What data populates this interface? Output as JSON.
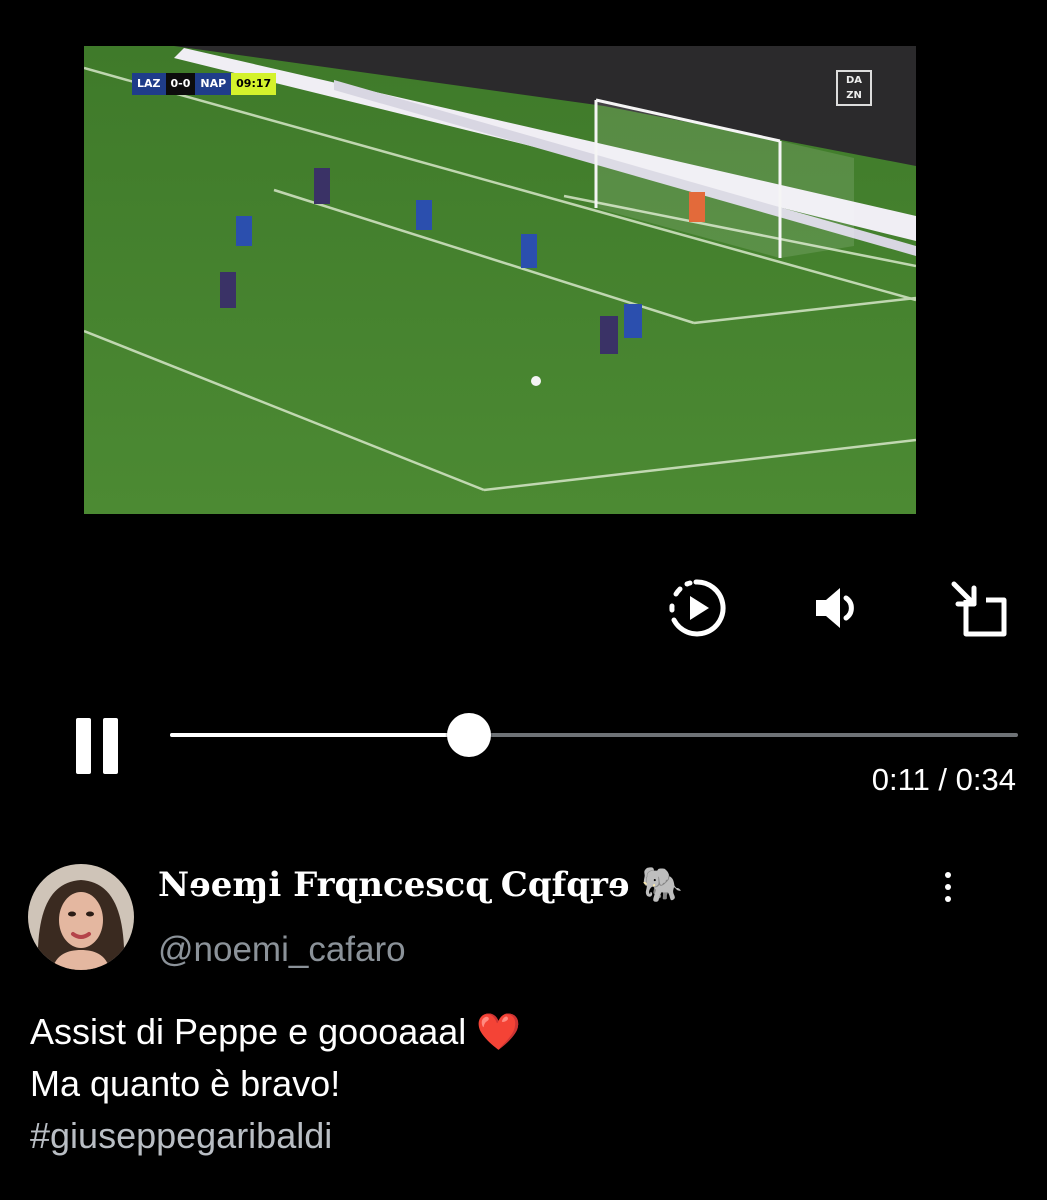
{
  "video": {
    "scorebug": {
      "home": "LAZ",
      "score": "0-0",
      "away": "NAP",
      "clock": "09:17"
    },
    "broadcaster_logo": "DAZN",
    "broadcaster_logo_lines": [
      "DA",
      "ZN"
    ]
  },
  "controls": {
    "replay_icon": "replay-icon",
    "volume_icon": "volume-icon",
    "exit_fullscreen_icon": "exit-fullscreen-icon",
    "pause_icon": "pause-icon",
    "progress_fraction": 0.3529,
    "time": "0:11 / 0:34"
  },
  "tweet": {
    "author_name": "Nɘeɱi Frɋncescɋ Cɋfɋrɘ 🐘",
    "handle": "@noemi_cafaro",
    "lines": [
      "Assist di Peppe e goooaaal ❤️",
      "Ma quanto è bravo!",
      "#giuseppegaribaldi"
    ],
    "more_icon": "more-vertical-icon"
  },
  "colors": {
    "background": "#000000",
    "text": "#ffffff",
    "muted": "#8b9299",
    "scoreboard_clock": "#d4f22c"
  }
}
